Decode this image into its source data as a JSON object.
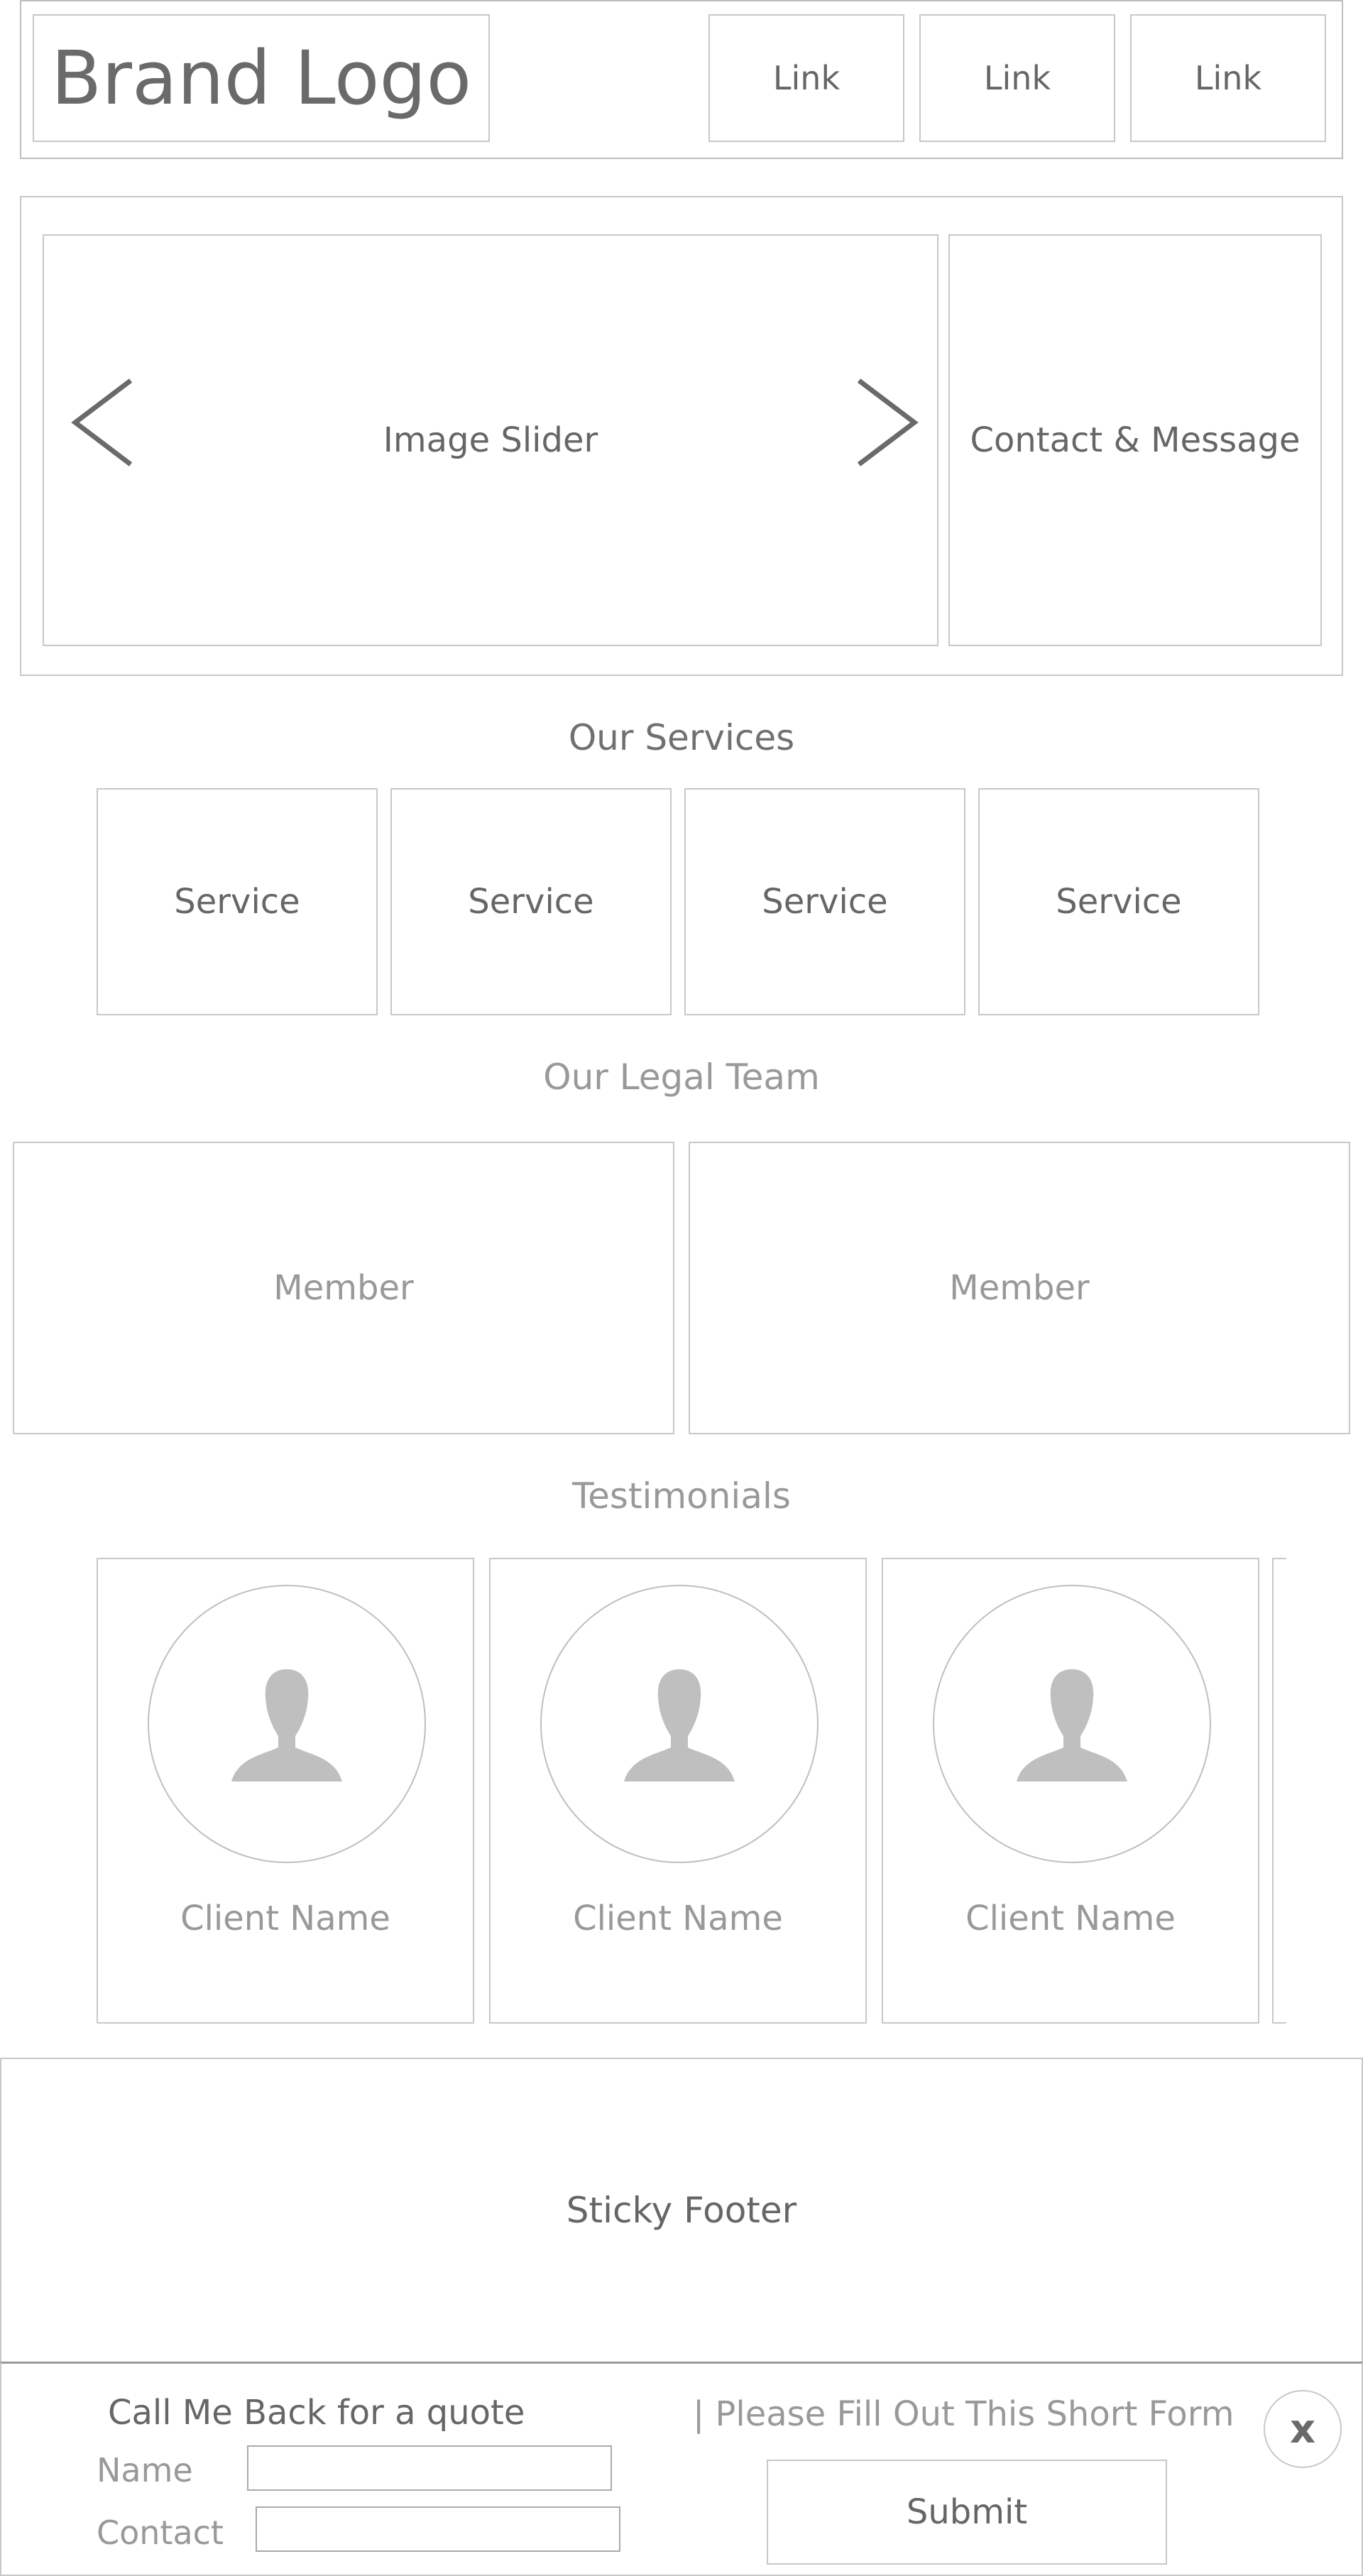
{
  "header": {
    "brand": "Brand Logo",
    "nav": [
      "Link",
      "Link",
      "Link"
    ]
  },
  "hero": {
    "slider_label": "Image Slider",
    "contact_label": "Contact & Message"
  },
  "services": {
    "title": "Our Services",
    "items": [
      "Service",
      "Service",
      "Service",
      "Service"
    ]
  },
  "team": {
    "title": "Our Legal Team",
    "members": [
      "Member",
      "Member"
    ]
  },
  "testimonials": {
    "title": "Testimonials",
    "clients": [
      "Client Name",
      "Client Name",
      "Client Name"
    ]
  },
  "footer": {
    "label": "Sticky Footer"
  },
  "callback": {
    "title": "Call Me Back for a quote",
    "subtitle": "| Please Fill Out This Short Form",
    "close_label": "x",
    "name_label": "Name",
    "contact_label": "Contact",
    "name_value": "",
    "contact_value": "",
    "submit_label": "Submit"
  },
  "icons": {
    "prev": "chevron-left-icon",
    "next": "chevron-right-icon",
    "avatar": "user-silhouette-icon",
    "close": "close-icon"
  },
  "colors": {
    "border": "#c8c8c8",
    "text": "#666666",
    "muted_text": "#999999",
    "silhouette": "#bfbfbf"
  }
}
